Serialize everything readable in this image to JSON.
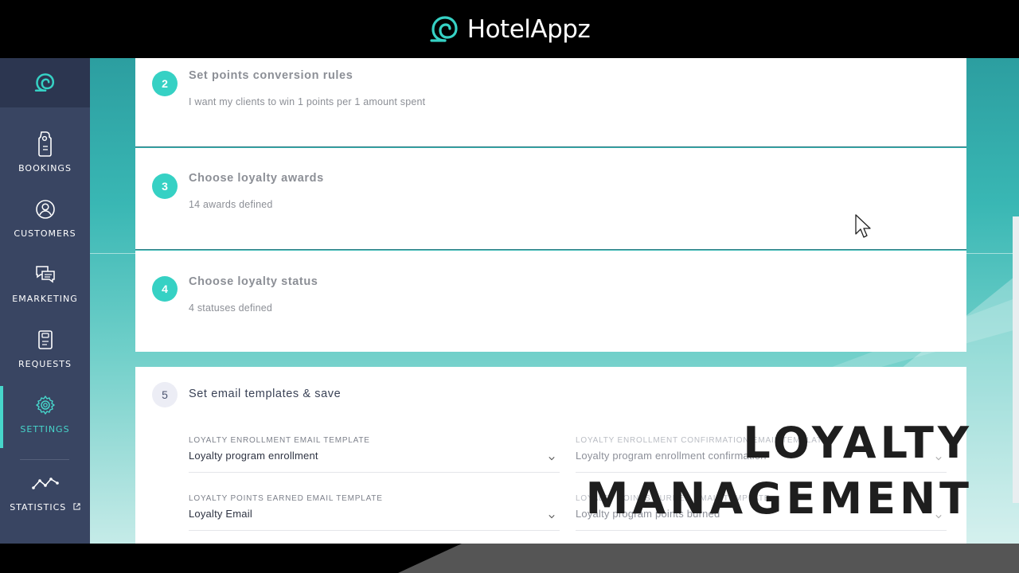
{
  "brand": {
    "name": "HotelAppz"
  },
  "sidebar": {
    "items": [
      {
        "label": "BOOKINGS",
        "icon": "door-hanger-icon",
        "active": false
      },
      {
        "label": "CUSTOMERS",
        "icon": "user-circle-icon",
        "active": false
      },
      {
        "label": "EMARKETING",
        "icon": "chat-bubble-icon",
        "active": false
      },
      {
        "label": "REQUESTS",
        "icon": "clipboard-icon",
        "active": false
      },
      {
        "label": "SETTINGS",
        "icon": "gear-icon",
        "active": true
      },
      {
        "label": "STATISTICS",
        "icon": "line-chart-icon",
        "active": false,
        "external": true
      }
    ]
  },
  "steps": [
    {
      "number": "2",
      "title": "Set points conversion rules",
      "subtitle": "I want my clients to win 1 points per 1 amount spent"
    },
    {
      "number": "3",
      "title": "Choose loyalty awards",
      "subtitle": "14 awards defined"
    },
    {
      "number": "4",
      "title": "Choose loyalty status",
      "subtitle": "4 statuses defined"
    },
    {
      "number": "5",
      "title": "Set email templates & save"
    }
  ],
  "email_templates": [
    {
      "label": "LOYALTY ENROLLMENT EMAIL TEMPLATE",
      "value": "Loyalty program enrollment"
    },
    {
      "label": "LOYALTY ENROLLMENT CONFIRMATION EMAIL TEMPLATE",
      "value": "Loyalty program enrollment confirmation"
    },
    {
      "label": "LOYALTY POINTS EARNED EMAIL TEMPLATE",
      "value": "Loyalty Email"
    },
    {
      "label": "LOYALTY POINTS BURNED EMAIL TEMPLATE",
      "value": "Loyalty program points burned"
    }
  ],
  "overlay": {
    "line1": "LOYALTY",
    "line2": "MANAGEMENT"
  },
  "colors": {
    "accent": "#36d1c4",
    "sidebar": "#394562",
    "sidebar_logo_bg": "#2c3650",
    "teal_bg": "#39b7b4"
  }
}
